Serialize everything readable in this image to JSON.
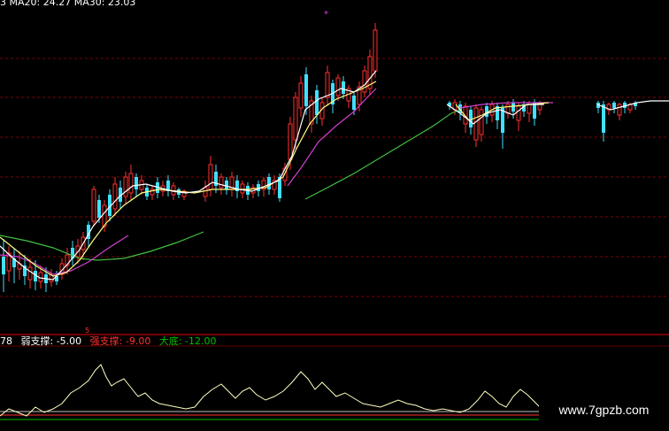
{
  "header": {
    "ma_text": "3  MA20: 24.27  MA30: 23.03"
  },
  "indicator": {
    "prefix": "78",
    "weak_label": "弱支撑: -5.00",
    "strong_label": "强支撑: -9.00",
    "bottom_label": "大底: -12.00"
  },
  "watermark": {
    "text": "www.7gpzb.com"
  },
  "marker": {
    "text": "5"
  },
  "colors": {
    "background": "#000000",
    "up": "#ff3030",
    "down": "#40e0ff",
    "ma5": "#ffffff",
    "ma10": "#ffff80",
    "ma20": "#d040d0",
    "ma30": "#40c040",
    "grid": "#800000",
    "weak": "#ffffff",
    "strong": "#ff3030",
    "bottom": "#00c000"
  }
}
